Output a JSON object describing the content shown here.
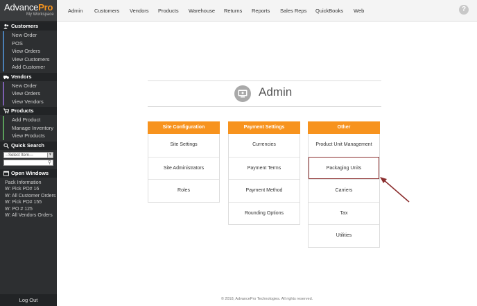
{
  "logo": {
    "main": "Advance",
    "accent": "Pro",
    "sub": "My Workspace"
  },
  "sidebar": {
    "customers": {
      "title": "Customers",
      "items": [
        "New Order",
        "POS",
        "View Orders",
        "View Customers",
        "Add Customer"
      ]
    },
    "vendors": {
      "title": "Vendors",
      "items": [
        "New Order",
        "View Orders",
        "View Vendors"
      ]
    },
    "products": {
      "title": "Products",
      "items": [
        "Add Product",
        "Manage Inventory",
        "View Products"
      ]
    },
    "quick_search": {
      "title": "Quick Search",
      "select_value": "--Select Item---"
    },
    "open_windows": {
      "title": "Open Windows",
      "items": [
        "Pack Information",
        "W: Pick PO# 16",
        "W: All Customer Orders",
        "W: Pick PO# 155",
        "W: PO # 125",
        "W: All Vendors Orders"
      ]
    },
    "logout": "Log Out"
  },
  "nav": [
    "Admin",
    "Customers",
    "Vendors",
    "Products",
    "Warehouse",
    "Returns",
    "Reports",
    "Sales Reps",
    "QuickBooks",
    "Web"
  ],
  "help": "?",
  "page_title": "Admin",
  "panels": [
    {
      "title": "Site Configuration",
      "items": [
        "Site Settings",
        "Site Administrators",
        "Roles"
      ]
    },
    {
      "title": "Payment Settings",
      "items": [
        "Currencies",
        "Payment Terms",
        "Payment Method",
        "Rounding Options"
      ]
    },
    {
      "title": "Other",
      "items": [
        "Product Unit Management",
        "Packaging Units",
        "Carriers",
        "Tax",
        "Utilities"
      ]
    }
  ],
  "footer": "© 2018, AdvancePro Technologies. All rights reserved.",
  "colors": {
    "accent": "#f7931e",
    "highlight": "#8b2e2e",
    "sidebar": "#2d2f31"
  }
}
